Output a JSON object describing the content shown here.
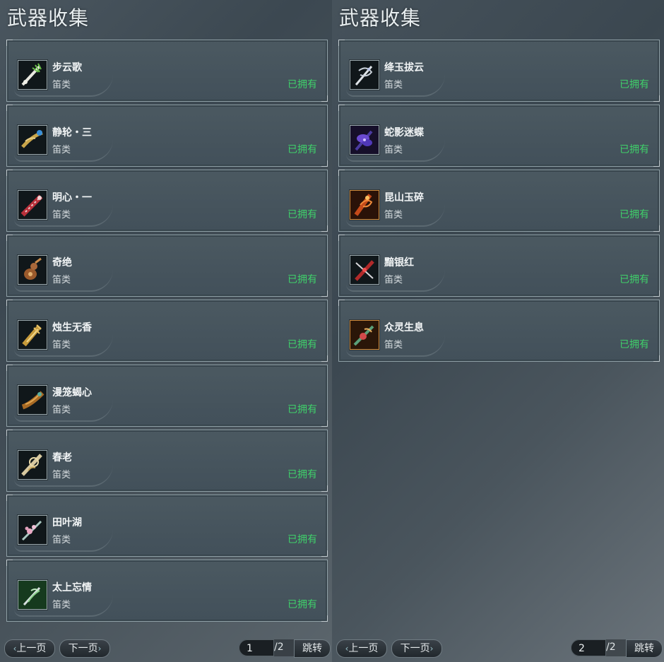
{
  "left": {
    "title": "武器收集",
    "items": [
      {
        "name": "步云歌",
        "type": "笛类",
        "status": "已拥有",
        "icon": "flute-green-white-icon"
      },
      {
        "name": "静轮・三",
        "type": "笛类",
        "status": "已拥有",
        "icon": "flute-gold-blue-icon"
      },
      {
        "name": "明心・一",
        "type": "笛类",
        "status": "已拥有",
        "icon": "flute-red-icon"
      },
      {
        "name": "奇绝",
        "type": "笛类",
        "status": "已拥有",
        "icon": "flute-gourd-icon"
      },
      {
        "name": "烛生无香",
        "type": "笛类",
        "status": "已拥有",
        "icon": "flute-gold-icon"
      },
      {
        "name": "漫笼蝎心",
        "type": "笛类",
        "status": "已拥有",
        "icon": "flute-bronze-icon"
      },
      {
        "name": "春老",
        "type": "笛类",
        "status": "已拥有",
        "icon": "flute-cream-icon"
      },
      {
        "name": "田叶湖",
        "type": "笛类",
        "status": "已拥有",
        "icon": "flute-pink-flower-icon"
      },
      {
        "name": "太上忘情",
        "type": "笛类",
        "status": "已拥有",
        "icon": "flute-green-silver-icon"
      }
    ],
    "pager": {
      "prev": "上一页",
      "next": "下一页",
      "current": "1",
      "total": "/2",
      "jump": "跳转"
    }
  },
  "right": {
    "title": "武器收集",
    "items": [
      {
        "name": "绛玉拔云",
        "type": "笛类",
        "status": "已拥有",
        "icon": "flute-silver-icon"
      },
      {
        "name": "蛇影迷蝶",
        "type": "笛类",
        "status": "已拥有",
        "icon": "flute-purple-butterfly-icon"
      },
      {
        "name": "昆山玉碎",
        "type": "笛类",
        "status": "已拥有",
        "icon": "flute-orange-dragon-icon"
      },
      {
        "name": "黯银红",
        "type": "笛类",
        "status": "已拥有",
        "icon": "flute-red-silver-icon"
      },
      {
        "name": "众灵生息",
        "type": "笛类",
        "status": "已拥有",
        "icon": "flute-orange-green-icon"
      }
    ],
    "pager": {
      "prev": "上一页",
      "next": "下一页",
      "current": "2",
      "total": "/2",
      "jump": "跳转"
    }
  },
  "colors": {
    "owned": "#3fd06a",
    "title": "#e8eef0"
  }
}
